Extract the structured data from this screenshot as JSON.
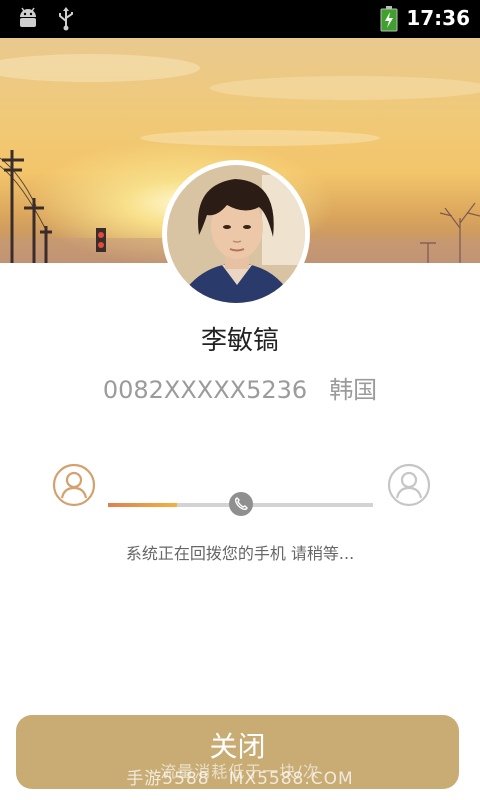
{
  "status_bar": {
    "time": "17:36",
    "icons": [
      "android-debug-icon",
      "usb-icon",
      "battery-charging-icon"
    ]
  },
  "contact": {
    "name": "李敏镐",
    "phone": "0082XXXXX5236",
    "country": "韩国"
  },
  "progress": {
    "fraction": 0.5,
    "status_text": "系统正在回拨您的手机 请稍等..."
  },
  "actions": {
    "close_label": "关闭"
  },
  "watermark": {
    "text": "手游5588 · MX5588.COM",
    "overlay_text": "流量消耗低于一块/次"
  },
  "colors": {
    "accent": "#c8ac74",
    "progress_start": "#e07f52",
    "progress_end": "#f0b33e",
    "track": "#d3d3d3"
  }
}
